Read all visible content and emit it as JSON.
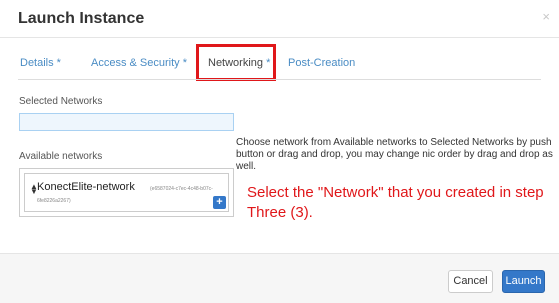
{
  "modal": {
    "title": "Launch Instance",
    "close_symbol": "×"
  },
  "tabs": [
    {
      "label": "Details",
      "required_mark": " *",
      "active": false
    },
    {
      "label": "Access & Security",
      "required_mark": " *",
      "active": false
    },
    {
      "label": "Networking",
      "required_mark": " *",
      "active": true
    },
    {
      "label": "Post-Creation",
      "required_mark": "",
      "active": false
    }
  ],
  "networking": {
    "selected_label": "Selected Networks",
    "available_label": "Available networks",
    "help_text": "Choose network from Available networks to Selected Networks by push button or drag and drop, you may change nic order by drag and drop as well.",
    "available_networks": [
      {
        "name": "KonectElite-network",
        "id_part1": "(e6587024-c7ec-4c48-b07c-",
        "id_part2": "6fe8226a2267)",
        "add_symbol": "+"
      }
    ]
  },
  "annotation": {
    "text": "Select the \"Network\" that you created in step Three (3).",
    "color": "#e0171a"
  },
  "footer": {
    "cancel_label": "Cancel",
    "launch_label": "Launch"
  },
  "colors": {
    "primary": "#3478c9",
    "link": "#4a8cc4",
    "highlight": "#e0171a"
  },
  "icons": {
    "close": "close-icon",
    "sort": "sort-icon",
    "add": "plus-icon"
  }
}
